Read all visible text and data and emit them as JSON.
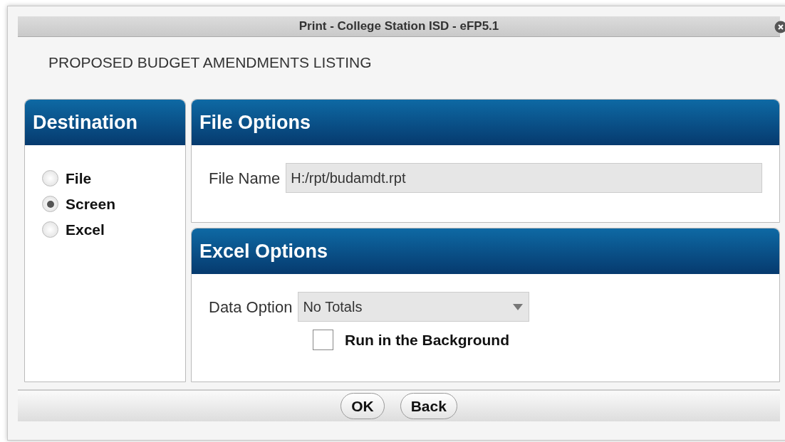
{
  "window": {
    "title": "Print - College Station ISD - eFP5.1"
  },
  "report_title": "PROPOSED BUDGET AMENDMENTS LISTING",
  "destination": {
    "title": "Destination",
    "options": [
      {
        "label": "File",
        "selected": false
      },
      {
        "label": "Screen",
        "selected": true
      },
      {
        "label": "Excel",
        "selected": false
      }
    ]
  },
  "file_options": {
    "title": "File Options",
    "file_name": {
      "label": "File Name",
      "value": "H:/rpt/budamdt.rpt"
    }
  },
  "excel_options": {
    "title": "Excel Options",
    "data_option": {
      "label": "Data Option",
      "value": "No Totals"
    },
    "run_in_background": {
      "label": "Run in the Background",
      "checked": false
    }
  },
  "buttons": [
    "OK",
    "Back"
  ]
}
